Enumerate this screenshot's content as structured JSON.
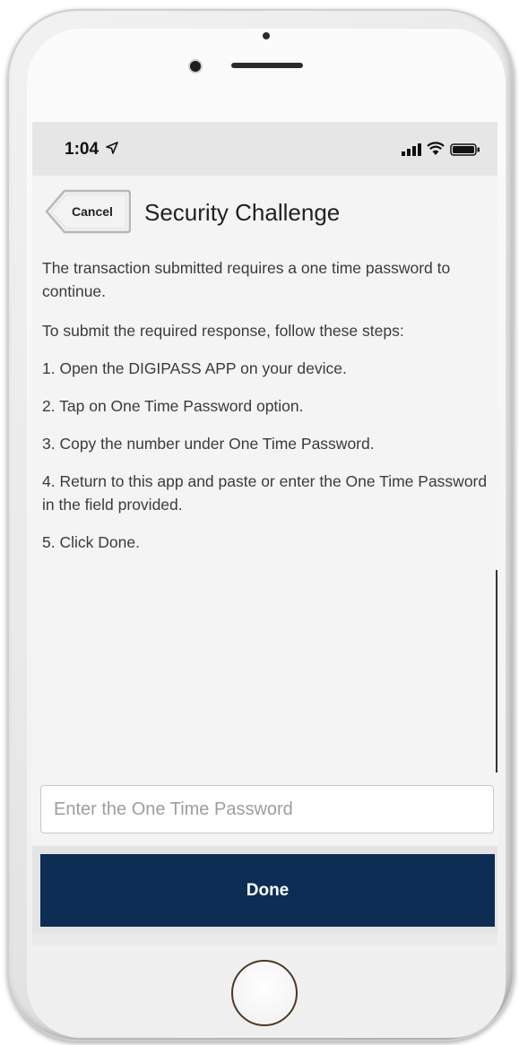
{
  "status_bar": {
    "time": "1:04"
  },
  "nav": {
    "cancel_label": "Cancel",
    "title": "Security Challenge"
  },
  "body": {
    "intro": "The transaction submitted requires a one time password to continue.",
    "steps_intro": "To submit the required response, follow these steps:",
    "steps": [
      "1. Open the DIGIPASS APP on your device.",
      "2. Tap on One Time Password option.",
      "3. Copy the number under One Time Password.",
      "4. Return to this app and paste or enter the One Time Password in the field provided.",
      "5. Click Done."
    ]
  },
  "otp": {
    "placeholder": "Enter the One Time Password",
    "value": ""
  },
  "done_label": "Done",
  "colors": {
    "done_button": "#0e2d55",
    "screen_bg": "#f4f4f4",
    "status_bar_bg": "#e6e6e6"
  }
}
